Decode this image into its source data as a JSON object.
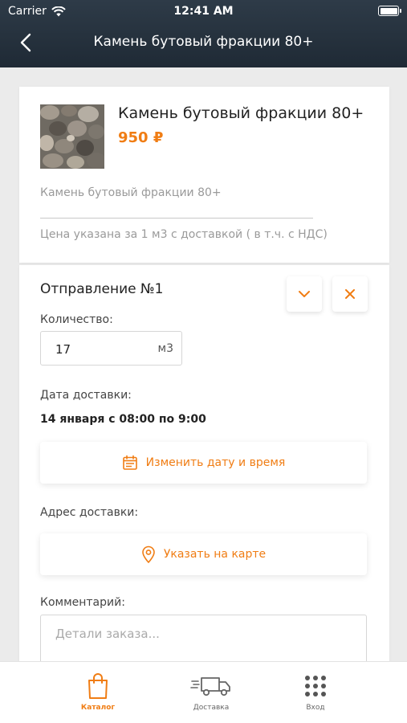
{
  "status_bar": {
    "carrier": "Carrier",
    "time": "12:41 AM"
  },
  "navbar": {
    "title": "Камень бутовый фракции 80+"
  },
  "product": {
    "title": "Камень бутовый фракции 80+",
    "price": "950 ₽",
    "description": "Камень бутовый фракции 80+",
    "price_note": "Цена указана за 1 м3 с доставкой ( в т.ч. с НДС)"
  },
  "shipment": {
    "title": "Отправление №1",
    "quantity_label": "Количество:",
    "quantity_value": "17",
    "quantity_unit": "м3",
    "date_label": "Дата доставки:",
    "date_value": "14 января с 08:00 по 9:00",
    "change_date_button": "Изменить дату и время",
    "address_label": "Адрес доставки:",
    "map_button": "Указать на карте",
    "comment_label": "Комментарий:",
    "comment_placeholder": "Детали заказа..."
  },
  "tabbar": {
    "items": [
      {
        "label": "Каталог",
        "icon": "shopping-bag-icon",
        "active": true
      },
      {
        "label": "Доставка",
        "icon": "truck-icon",
        "active": false
      },
      {
        "label": "Вход",
        "icon": "grid-dots-icon",
        "active": false
      }
    ]
  },
  "colors": {
    "accent": "#f07d14",
    "header": "#26323e",
    "background": "#ebebeb"
  }
}
